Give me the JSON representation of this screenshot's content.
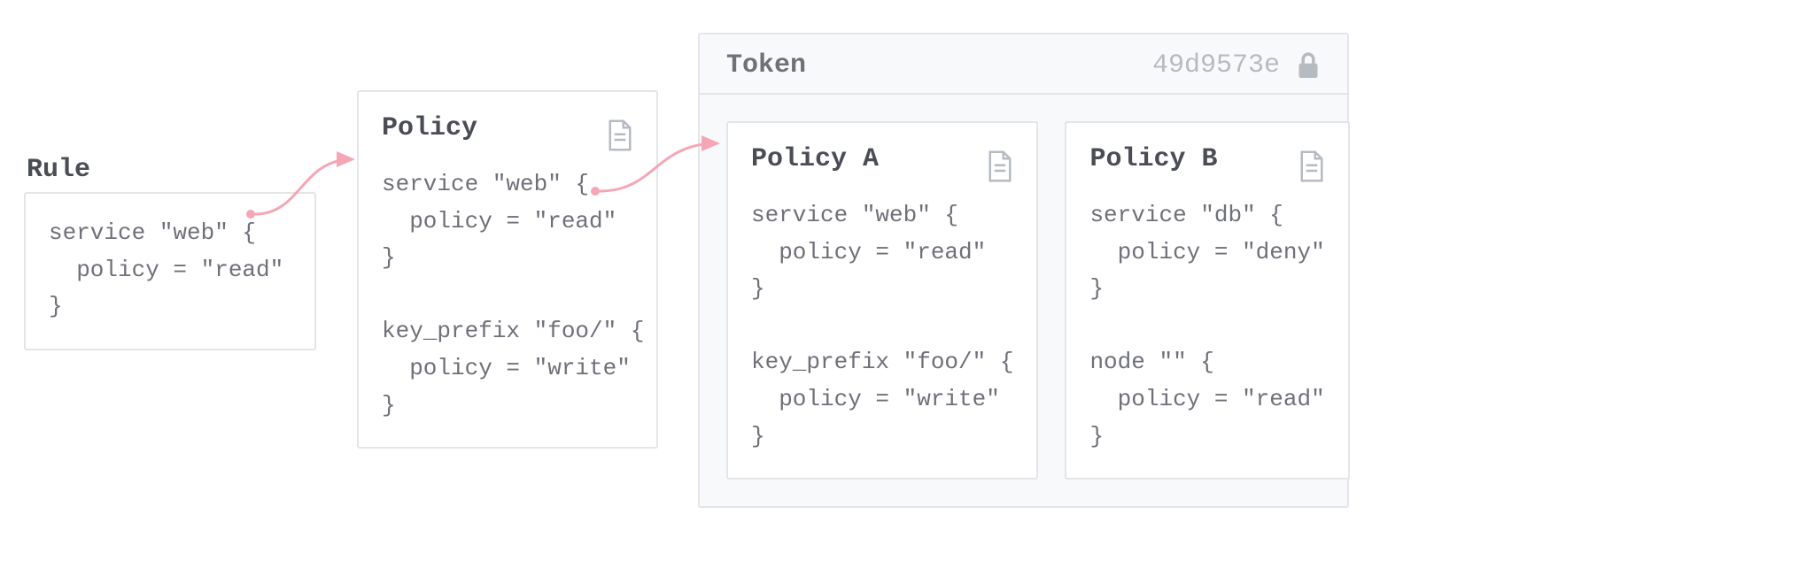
{
  "rule": {
    "label": "Rule",
    "code": "service \"web\" {\n  policy = \"read\"\n}"
  },
  "policy": {
    "title": "Policy",
    "code": "service \"web\" {\n  policy = \"read\"\n}\n\nkey_prefix \"foo/\" {\n  policy = \"write\"\n}"
  },
  "token": {
    "title": "Token",
    "hash": "49d9573e",
    "policies": {
      "a": {
        "title": "Policy A",
        "code": "service \"web\" {\n  policy = \"read\"\n}\n\nkey_prefix \"foo/\" {\n  policy = \"write\"\n}"
      },
      "b": {
        "title": "Policy B",
        "code": "service \"db\" {\n  policy = \"deny\"\n}\n\nnode \"\" {\n  policy = \"read\"\n}"
      }
    }
  },
  "colors": {
    "border": "#e3e5e9",
    "arrow": "#f4a6b6",
    "text": "#6f7078",
    "bgToken": "#f8f9fb"
  }
}
